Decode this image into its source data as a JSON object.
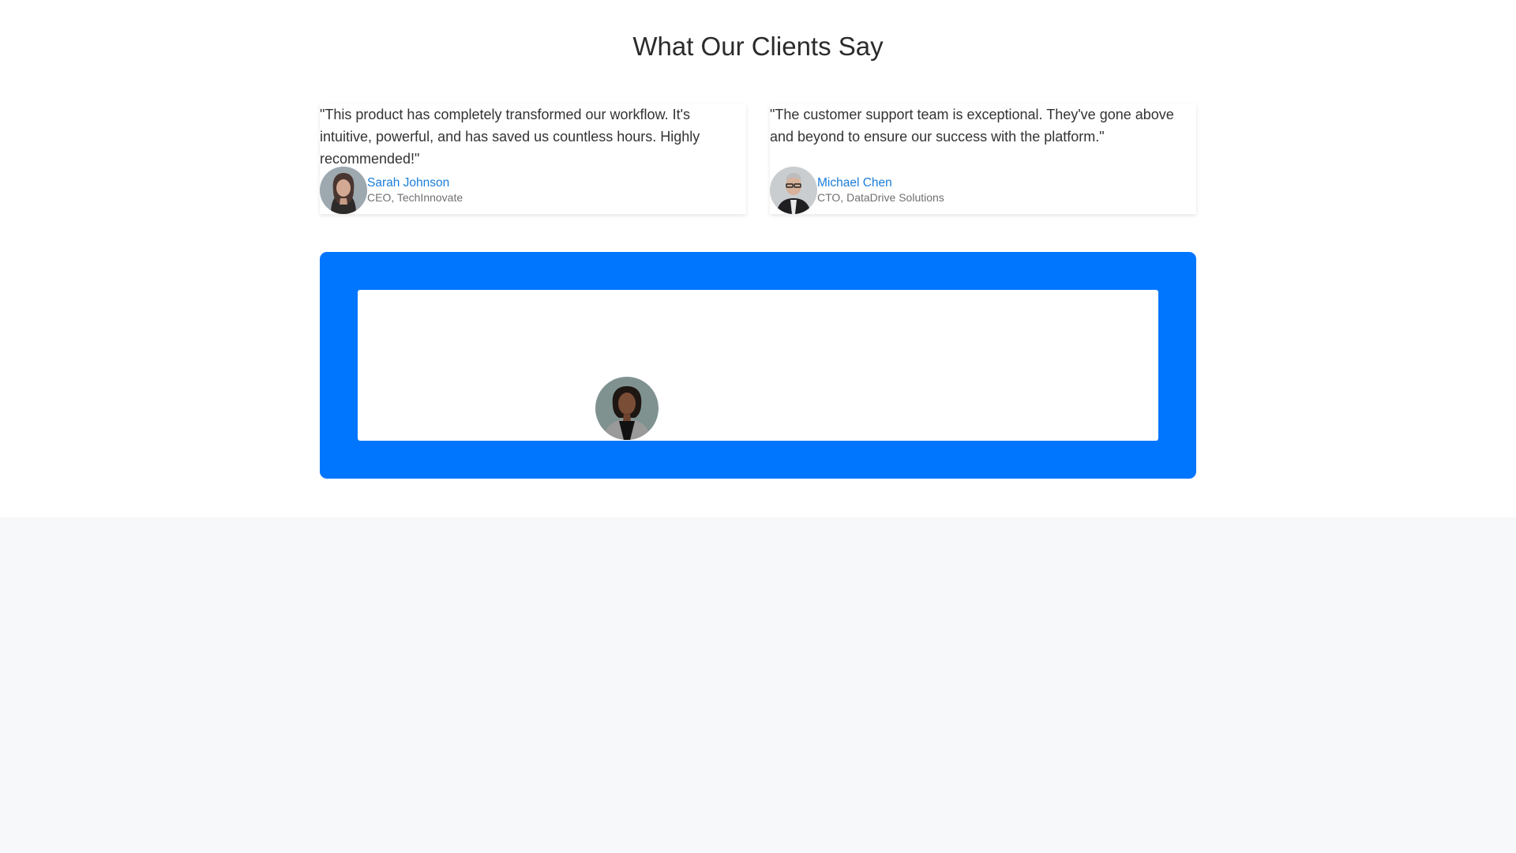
{
  "page": {
    "title": "What Our Clients Say"
  },
  "testimonials": [
    {
      "quote": "\"This product has completely transformed our workflow. It's intuitive, powerful, and has saved us countless hours. Highly recommended!\"",
      "name": "Sarah Johnson",
      "role": "CEO, TechInnovate",
      "avatar_icon": "woman-portrait"
    },
    {
      "quote": "\"The customer support team is exceptional. They've gone above and beyond to ensure our success with the platform.\"",
      "name": "Michael Chen",
      "role": "CTO, DataDrive Solutions",
      "avatar_icon": "man-portrait"
    }
  ],
  "featured": {
    "avatar_icon": "woman-portrait"
  },
  "colors": {
    "accent": "#0076ff",
    "name_link": "#1a7ddb",
    "page_bg": "#f7f8fa"
  }
}
